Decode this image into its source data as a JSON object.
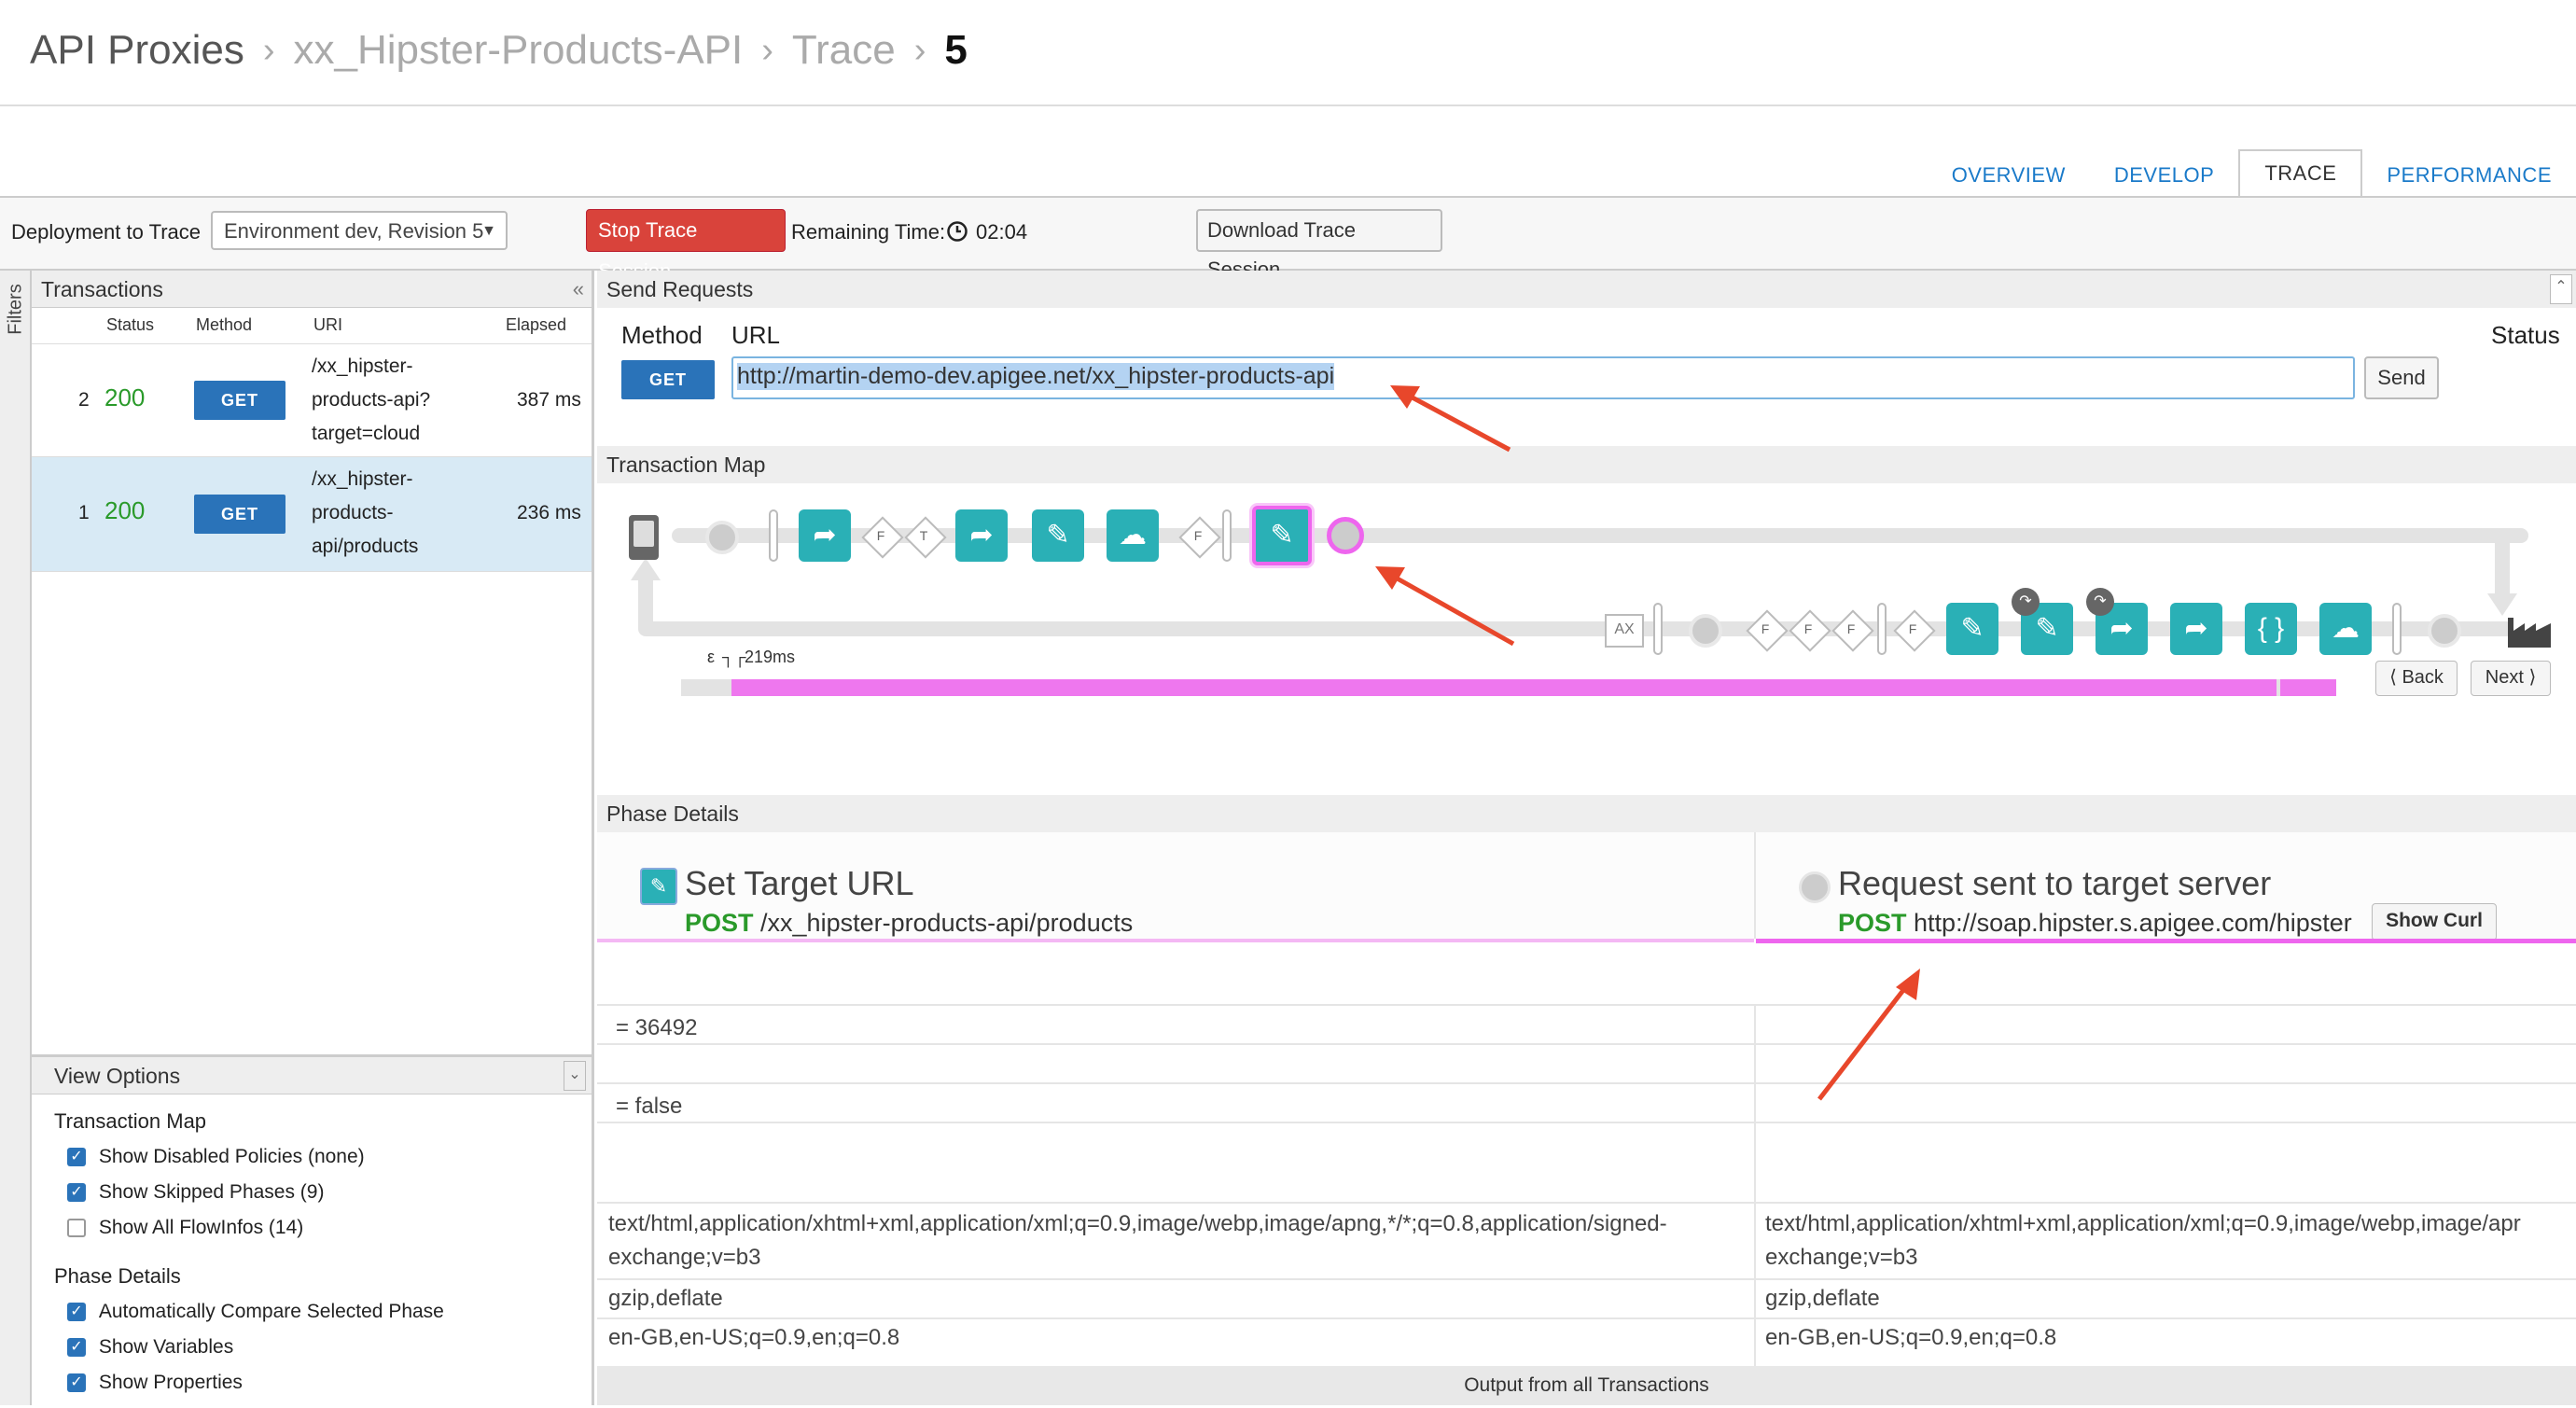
{
  "breadcrumb": {
    "items": [
      "API Proxies",
      "xx_Hipster-Products-API",
      "Trace",
      "5"
    ]
  },
  "tabs": [
    "OVERVIEW",
    "DEVELOP",
    "TRACE",
    "PERFORMANCE"
  ],
  "toolbar": {
    "deployment_label": "Deployment to Trace",
    "deployment_value": "Environment dev, Revision 5",
    "stop_label": "Stop Trace Session",
    "remaining_label": "Remaining Time:",
    "remaining_value": "02:04",
    "download_label": "Download Trace Session"
  },
  "sidebar": {
    "filters_label": "Filters"
  },
  "transactions": {
    "title": "Transactions",
    "columns": [
      "Status",
      "Method",
      "URI",
      "Elapsed"
    ],
    "rows": [
      {
        "num": "2",
        "status": "200",
        "method": "GET",
        "uri": [
          "/xx_hipster-",
          "products-api?",
          "target=cloud"
        ],
        "elapsed": "387 ms"
      },
      {
        "num": "1",
        "status": "200",
        "method": "GET",
        "uri": [
          "/xx_hipster-",
          "products-",
          "api/products"
        ],
        "elapsed": "236 ms"
      }
    ]
  },
  "view_options": {
    "title": "View Options",
    "tm_title": "Transaction Map",
    "tm_items": [
      {
        "label": "Show Disabled Policies (none)",
        "checked": true
      },
      {
        "label": "Show Skipped Phases (9)",
        "checked": true
      },
      {
        "label": "Show All FlowInfos (14)",
        "checked": false
      }
    ],
    "pd_title": "Phase Details",
    "pd_items": [
      {
        "label": "Automatically Compare Selected Phase",
        "checked": true
      },
      {
        "label": "Show Variables",
        "checked": true
      },
      {
        "label": "Show Properties",
        "checked": true
      }
    ]
  },
  "send_requests": {
    "title": "Send Requests",
    "method_label": "Method",
    "url_label": "URL",
    "status_label": "Status",
    "method": "GET",
    "url": "http://martin-demo-dev.apigee.net/xx_hipster-products-api",
    "send_label": "Send"
  },
  "transaction_map": {
    "title": "Transaction Map",
    "flow_labels": [
      "F",
      "T",
      "F",
      "F",
      "F",
      "F",
      "F"
    ],
    "ax_label": "AX",
    "timing_top": "ε",
    "timing_label": "219ms",
    "back_label": "Back",
    "next_label": "Next"
  },
  "phase_details": {
    "title": "Phase Details",
    "left": {
      "title": "Set Target URL",
      "verb": "POST",
      "path": "/xx_hipster-products-api/products"
    },
    "right": {
      "title": "Request sent to target server",
      "verb": "POST",
      "path": "http://soap.hipster.s.apigee.com/hipster",
      "curl_label": "Show Curl"
    },
    "values": [
      "= 36492",
      "= false"
    ],
    "headers_left": [
      "text/html,application/xhtml+xml,application/xml;q=0.9,image/webp,image/apng,*/*;q=0.8,application/signed-",
      "exchange;v=b3",
      "gzip,deflate",
      "en-GB,en-US;q=0.9,en;q=0.8"
    ],
    "headers_right": [
      "text/html,application/xhtml+xml,application/xml;q=0.9,image/webp,image/apr",
      "exchange;v=b3",
      "gzip,deflate",
      "en-GB,en-US;q=0.9,en;q=0.8"
    ],
    "footer": "Output from all Transactions"
  },
  "colors": {
    "accent": "#2a73b9",
    "policy": "#2ab0b6",
    "highlight": "#ee66ee",
    "ok": "#2a9a2a",
    "stop": "#d9433b",
    "annotation": "#e8472b"
  },
  "icons": [
    "phone-icon",
    "share-icon",
    "pencil-icon",
    "cloud-check-icon",
    "braces-icon",
    "factory-icon",
    "clock-icon",
    "chevron-left-icon",
    "chevron-right-icon"
  ]
}
